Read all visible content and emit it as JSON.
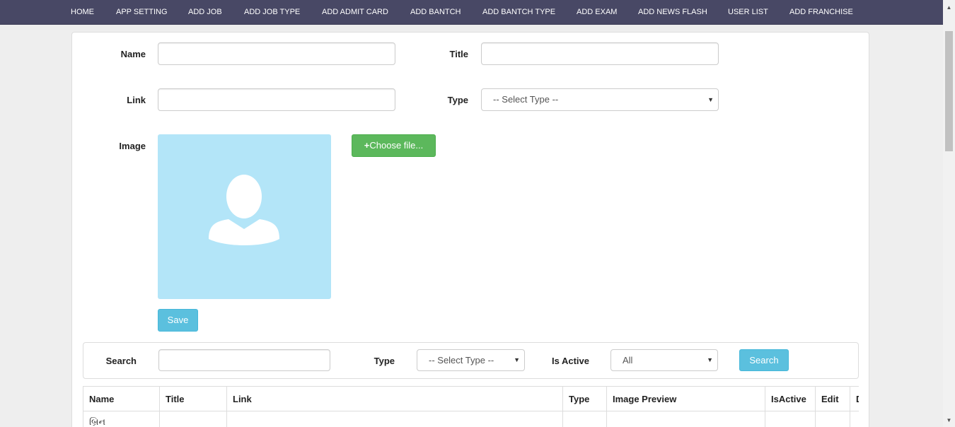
{
  "nav": [
    {
      "label": "HOME"
    },
    {
      "label": "APP SETTING"
    },
    {
      "label": "ADD JOB"
    },
    {
      "label": "ADD JOB TYPE"
    },
    {
      "label": "ADD ADMIT CARD"
    },
    {
      "label": "ADD BANTCH"
    },
    {
      "label": "ADD BANTCH TYPE"
    },
    {
      "label": "ADD EXAM"
    },
    {
      "label": "ADD NEWS FLASH"
    },
    {
      "label": "USER LIST"
    },
    {
      "label": "ADD FRANCHISE"
    }
  ],
  "form": {
    "name_label": "Name",
    "name_value": "",
    "title_label": "Title",
    "title_value": "",
    "link_label": "Link",
    "link_value": "",
    "type_label": "Type",
    "type_selected": "-- Select Type --",
    "image_label": "Image",
    "choose_file_label": "Choose file...",
    "save_label": "Save"
  },
  "filter": {
    "search_label": "Search",
    "search_value": "",
    "type_label": "Type",
    "type_selected": "-- Select Type --",
    "active_label": "Is Active",
    "active_selected": "All",
    "search_button": "Search"
  },
  "table": {
    "headers": [
      "Name",
      "Title",
      "Link",
      "Type",
      "Image Preview",
      "IsActive",
      "Edit",
      "Delete"
    ],
    "rows": [
      {
        "name": "બ્રિન"
      }
    ]
  },
  "colors": {
    "navbar": "#484865",
    "success": "#5cb85c",
    "info": "#5bc0de",
    "image_placeholder": "#b3e5f8"
  }
}
